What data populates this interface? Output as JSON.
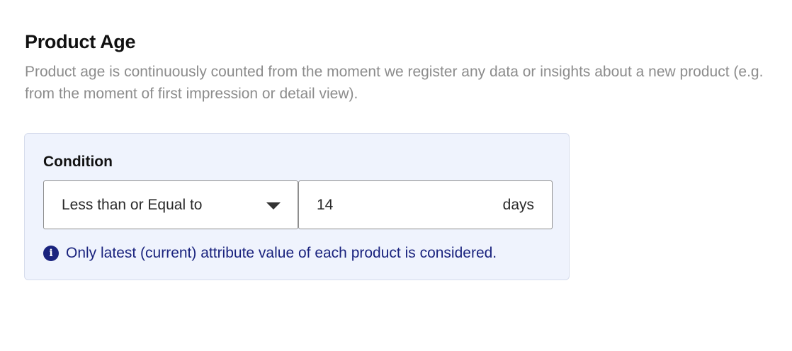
{
  "section": {
    "title": "Product Age",
    "description": "Product age is continuously counted from the moment we register any data or insights about a new product (e.g. from the moment of first impression or detail view)."
  },
  "condition": {
    "label": "Condition",
    "operator": {
      "selected": "Less than or Equal to",
      "icon": "chevron-down-icon"
    },
    "value": "14",
    "unit": "days",
    "note": {
      "icon": "info-icon",
      "text": "Only latest (current) attribute value of each product is considered."
    }
  },
  "colors": {
    "panel_background": "#eff3fd",
    "panel_border": "#d6dcec",
    "note_text": "#1a237e",
    "description_text": "#8c8c8c"
  }
}
